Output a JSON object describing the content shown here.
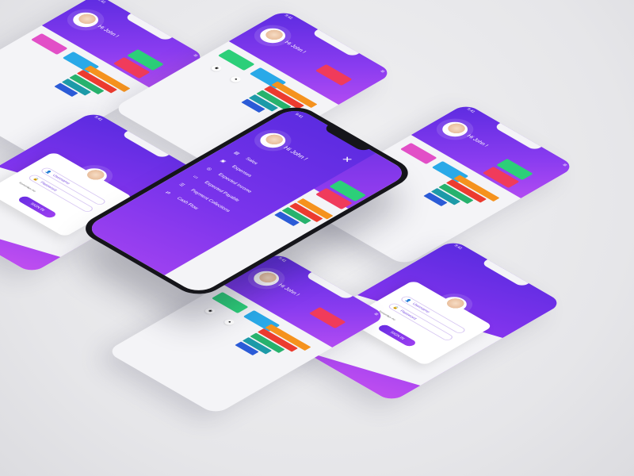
{
  "status_time": "9:41",
  "greeting": "Hi John !",
  "menu_glyph": "≡",
  "close_glyph": "✕",
  "login": {
    "username_placeholder": "Username",
    "password_placeholder": "Password",
    "remember_label": "Remember me",
    "signin_label": "SIGN IN"
  },
  "drawer": {
    "items": [
      {
        "label": "Sales",
        "icon": "chart-icon"
      },
      {
        "label": "Expenses",
        "icon": "wallet-icon"
      },
      {
        "label": "Expected Income",
        "icon": "coin-icon"
      },
      {
        "label": "Expected Payable",
        "icon": "card-icon"
      },
      {
        "label": "Payment Collections",
        "icon": "receipt-icon"
      },
      {
        "label": "Cash Flow",
        "icon": "flow-icon"
      }
    ]
  },
  "colors": {
    "primary": "#6a2ee3",
    "card_blue": "#29a9e8",
    "card_green": "#2ccf79",
    "card_red": "#f03b5b",
    "card_pink": "#e24fc7",
    "bar_orange": "#f5921e",
    "bar_red": "#ec3b2f",
    "bar_green": "#27b26d",
    "bar_teal": "#1d9aa8",
    "bar_blue": "#2b5bd7"
  }
}
